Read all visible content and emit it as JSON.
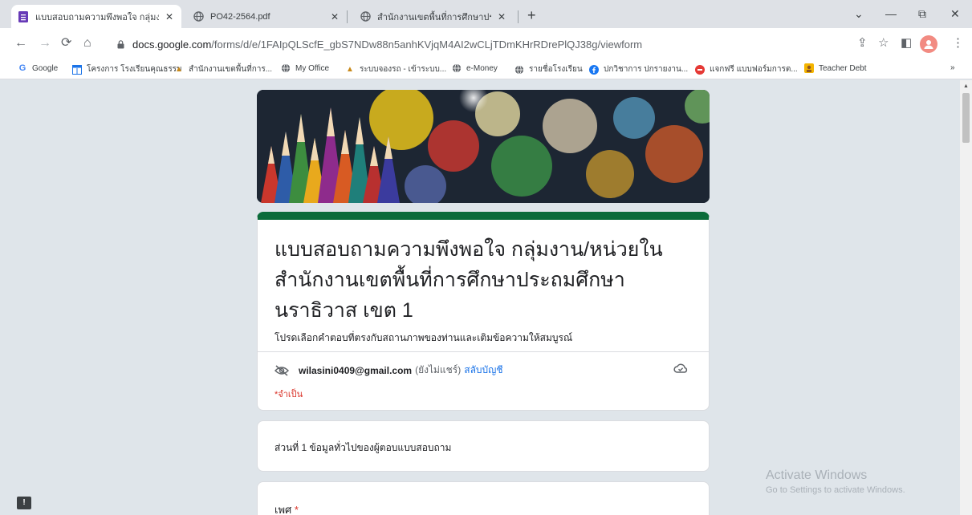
{
  "browser": {
    "tabs": [
      {
        "title": "แบบสอบถามความพึงพอใจ กลุ่มงาน/หน่",
        "icon": "forms-icon",
        "active": true
      },
      {
        "title": "PO42-2564.pdf",
        "icon": "globe-icon",
        "active": false
      },
      {
        "title": "สำนักงานเขตพื้นที่การศึกษาประถมศึก",
        "icon": "globe-icon",
        "active": false
      }
    ],
    "new_tab_label": "+",
    "window_controls": {
      "dropdown": "⌄",
      "minimize": "—",
      "restore": "⧉",
      "close": "✕"
    },
    "url_host": "docs.google.com",
    "url_path": "/forms/d/e/1FAIpQLScfE_gbS7NDw88n5anhKVjqM4AI2wCLjTDmKHrRDrePlQJ38g/viewform",
    "bookmarks": [
      {
        "label": "Google",
        "icon": "google-icon"
      },
      {
        "label": "โครงการ โรงเรียนคุณธรรม",
        "icon": "calendar-icon"
      },
      {
        "label": "สำนักงานเขตพื้นที่การ...",
        "icon": "temple-icon"
      },
      {
        "label": "My Office",
        "icon": "globe-icon"
      },
      {
        "label": "ระบบจองรถ - เข้าระบบ...",
        "icon": "temple-icon"
      },
      {
        "label": "e-Money",
        "icon": "globe-icon"
      },
      {
        "label": "รายชื่อโรงเรียน",
        "icon": "globe-icon"
      },
      {
        "label": "ปกวิชาการ ปกรายงาน...",
        "icon": "facebook-icon"
      },
      {
        "label": "แจกฟรี แบบฟอร์มการต...",
        "icon": "site-icon"
      },
      {
        "label": "Teacher Debt",
        "icon": "teacher-icon"
      }
    ],
    "bookmarks_more": "»"
  },
  "form": {
    "title": "แบบสอบถามความพึงพอใจ กลุ่มงาน/หน่วยในสำนักงานเขตพื้นที่การศึกษาประถมศึกษานราธิวาส เขต 1",
    "description": "โปรดเลือกคำตอบที่ตรงกับสถานภาพของท่านและเติมข้อความให้สมบูรณ์",
    "account_email": "wilasini0409@gmail.com",
    "account_status": "(ยังไม่แชร์)",
    "switch_account": "สลับบัญชี",
    "required_note": "*จำเป็น",
    "section_title": "ส่วนที่ 1 ข้อมูลทั่วไปของผู้ตอบแบบสอบถาม",
    "question_label": "เพศ",
    "question_required_mark": "*"
  },
  "watermark": {
    "line1": "Activate Windows",
    "line2": "Go to Settings to activate Windows."
  },
  "report_button": "!",
  "colors": {
    "theme_green": "#0b6b3a",
    "page_bg": "#dfe5ea",
    "link_blue": "#1a73e8",
    "required_red": "#d93025"
  }
}
